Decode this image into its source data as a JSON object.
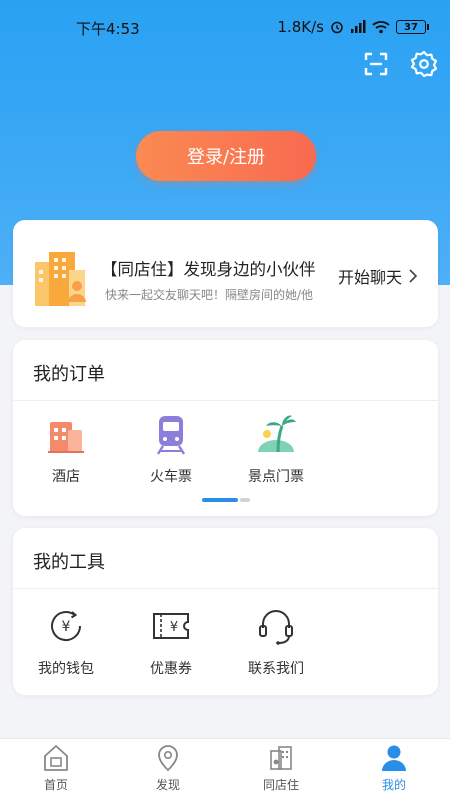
{
  "status_bar": {
    "time": "下午4:53",
    "speed": "1.8K/s",
    "battery": "37"
  },
  "header": {
    "scan_icon": "scan-icon",
    "settings_icon": "gear-icon"
  },
  "login": {
    "label": "登录/注册"
  },
  "promo": {
    "title": "【同店住】发现身边的小伙伴",
    "subtitle": "快来一起交友聊天吧！隔壁房间的她/他",
    "action": "开始聊天"
  },
  "orders": {
    "title": "我的订单",
    "items": [
      {
        "label": "酒店",
        "icon": "hotel-icon"
      },
      {
        "label": "火车票",
        "icon": "train-icon"
      },
      {
        "label": "景点门票",
        "icon": "scenic-ticket-icon"
      }
    ]
  },
  "tools": {
    "title": "我的工具",
    "items": [
      {
        "label": "我的钱包",
        "icon": "wallet-icon"
      },
      {
        "label": "优惠券",
        "icon": "coupon-icon"
      },
      {
        "label": "联系我们",
        "icon": "headset-icon"
      }
    ]
  },
  "tabbar": {
    "items": [
      {
        "label": "首页",
        "icon": "home-icon"
      },
      {
        "label": "发现",
        "icon": "location-icon"
      },
      {
        "label": "同店住",
        "icon": "same-hotel-icon"
      },
      {
        "label": "我的",
        "icon": "user-icon"
      }
    ],
    "active_index": 3
  },
  "colors": {
    "accent": "#2a8ee8",
    "hero_blue": "#2aa1f3",
    "login_orange": "#f96a50"
  }
}
